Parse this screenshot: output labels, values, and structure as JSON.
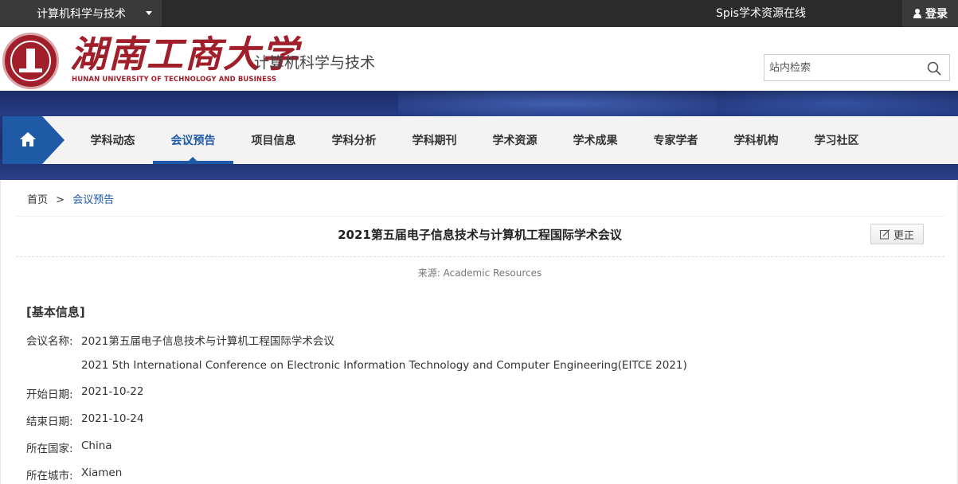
{
  "topbar": {
    "discipline_select": "计算机科学与技术",
    "site_name": "Spis学术资源在线",
    "login_label": "登录"
  },
  "header": {
    "university_name_cn": "湖南工商大学",
    "university_name_en": "HUNAN UNIVERSITY OF TECHNOLOGY AND BUSINESS",
    "department": "计算机科学与技术",
    "search_placeholder": "站内检索"
  },
  "nav": {
    "items": [
      {
        "label": "学科动态"
      },
      {
        "label": "会议预告"
      },
      {
        "label": "项目信息"
      },
      {
        "label": "学科分析"
      },
      {
        "label": "学科期刊"
      },
      {
        "label": "学术资源"
      },
      {
        "label": "学术成果"
      },
      {
        "label": "专家学者"
      },
      {
        "label": "学科机构"
      },
      {
        "label": "学习社区"
      }
    ],
    "active_index": 1
  },
  "breadcrumb": {
    "home": "首页",
    "separator": ">",
    "current": "会议预告"
  },
  "article": {
    "title": "2021第五届电子信息技术与计算机工程国际学术会议",
    "correct_label": "更正",
    "source": "来源:  Academic Resources"
  },
  "basic_info": {
    "heading": "[基本信息]",
    "conference_name_label": "会议名称:",
    "conference_name_cn": "2021第五届电子信息技术与计算机工程国际学术会议",
    "conference_name_en": "2021 5th International Conference on Electronic Information Technology and Computer Engineering(EITCE 2021)",
    "start_date_label": "开始日期:",
    "start_date": "2021-10-22",
    "end_date_label": "结束日期:",
    "end_date": "2021-10-24",
    "country_label": "所在国家:",
    "country": "China",
    "city_label": "所在城市:",
    "city": "Xiamen"
  }
}
